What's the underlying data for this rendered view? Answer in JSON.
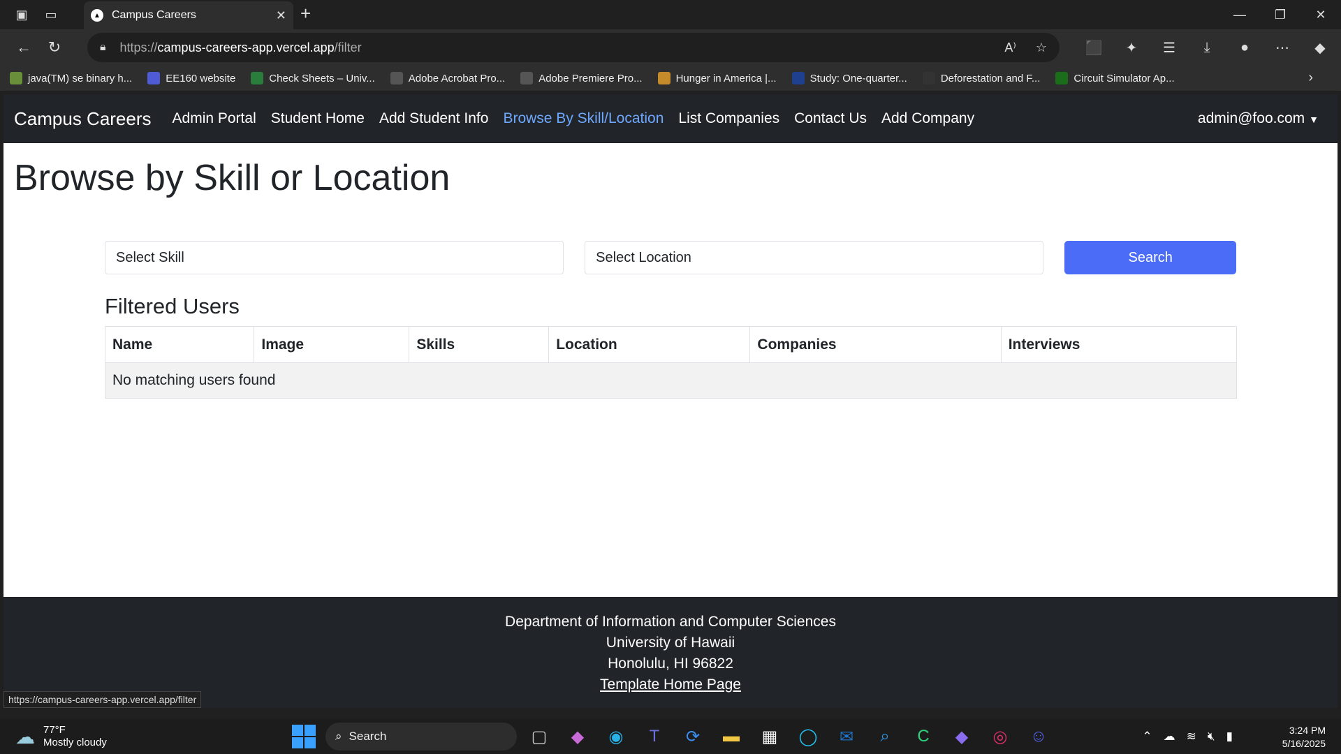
{
  "browser": {
    "tab_title": "Campus Careers",
    "url_scheme": "https://",
    "url_host": "campus-careers-app.vercel.app",
    "url_path": "/filter",
    "bookmarks": [
      {
        "label": "java(TM) se binary h...",
        "icon": "box-icon",
        "color": "#6a8f3a"
      },
      {
        "label": "EE160 website",
        "icon": "list-icon",
        "color": "#4f5bd5"
      },
      {
        "label": "Check Sheets – Univ...",
        "icon": "leaf-icon",
        "color": "#2a7d3a"
      },
      {
        "label": "Adobe Acrobat Pro...",
        "icon": "globe-icon",
        "color": "#555"
      },
      {
        "label": "Adobe Premiere Pro...",
        "icon": "globe-icon",
        "color": "#555"
      },
      {
        "label": "Hunger in America |...",
        "icon": "wheat-icon",
        "color": "#c58b2a"
      },
      {
        "label": "Study: One-quarter...",
        "icon": "upi-icon",
        "color": "#1f3f8f"
      },
      {
        "label": "Deforestation and F...",
        "icon": "panda-icon",
        "color": "#333"
      },
      {
        "label": "Circuit Simulator Ap...",
        "icon": "circuit-icon",
        "color": "#1a6e1a"
      }
    ]
  },
  "site": {
    "brand": "Campus Careers",
    "nav": [
      {
        "label": "Admin Portal",
        "active": false
      },
      {
        "label": "Student Home",
        "active": false
      },
      {
        "label": "Add Student Info",
        "active": false
      },
      {
        "label": "Browse By Skill/Location",
        "active": true
      },
      {
        "label": "List Companies",
        "active": false
      },
      {
        "label": "Contact Us",
        "active": false
      },
      {
        "label": "Add Company",
        "active": false
      }
    ],
    "user": "admin@foo.com"
  },
  "main": {
    "title": "Browse by Skill or Location",
    "skill_placeholder": "Select Skill",
    "location_placeholder": "Select Location",
    "search_label": "Search",
    "section_title": "Filtered Users",
    "columns": [
      "Name",
      "Image",
      "Skills",
      "Location",
      "Companies",
      "Interviews"
    ],
    "empty_message": "No matching users found"
  },
  "footer": {
    "line1": "Department of Information and Computer Sciences",
    "line2": "University of Hawaii",
    "line3": "Honolulu, HI 96822",
    "link": "Template Home Page"
  },
  "status_url": "https://campus-careers-app.vercel.app/filter",
  "taskbar": {
    "temperature": "77°F",
    "weather": "Mostly cloudy",
    "search": "Search",
    "time": "3:24 PM",
    "date": "5/16/2025"
  },
  "colors": {
    "accent": "#4a6cf7",
    "nav_active": "#6ea8fe",
    "navbar_bg": "#212529"
  }
}
